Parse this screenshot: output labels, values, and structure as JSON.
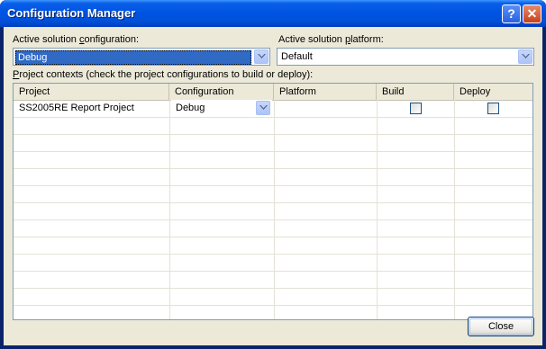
{
  "window": {
    "title": "Configuration Manager",
    "help_glyph": "?",
    "close_glyph": "✕"
  },
  "solution_config": {
    "label_pre": "Active solution ",
    "label_u": "c",
    "label_post": "onfiguration:",
    "value": "Debug"
  },
  "solution_platform": {
    "label_pre": "Active solution ",
    "label_u": "p",
    "label_post": "latform:",
    "value": "Default"
  },
  "project_contexts": {
    "label_u": "P",
    "label_post": "roject contexts (check the project configurations to build or deploy):"
  },
  "table": {
    "columns": [
      "Project",
      "Configuration",
      "Platform",
      "Build",
      "Deploy"
    ],
    "rows": [
      {
        "project": "SS2005RE Report Project",
        "configuration": "Debug",
        "platform": "",
        "build": false,
        "deploy": false
      }
    ]
  },
  "buttons": {
    "close": "Close"
  }
}
